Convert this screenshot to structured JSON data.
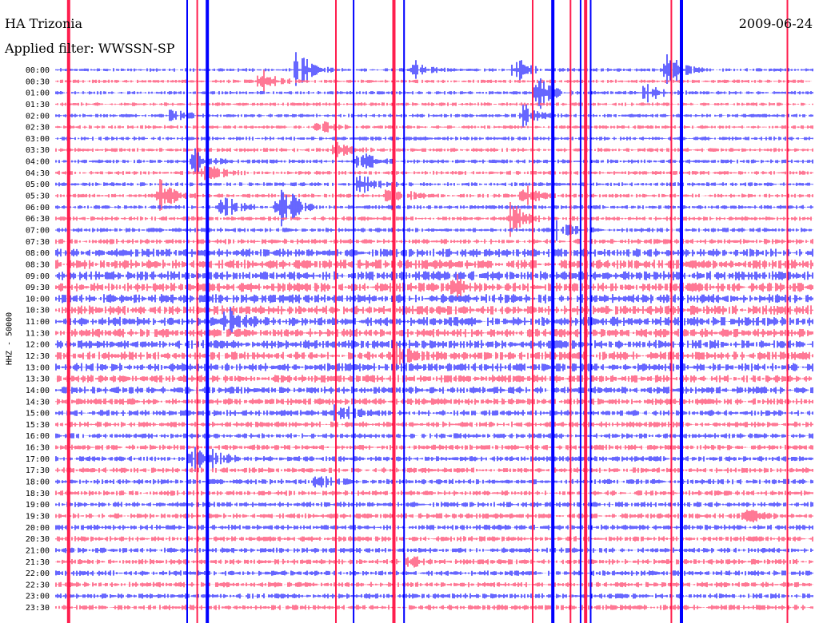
{
  "header": {
    "station": "HA Trizonia",
    "date": "2009-06-24",
    "filter": "Applied filter: WWSSN-SP"
  },
  "chart_data": {
    "type": "helicorder",
    "title": "HA Trizonia",
    "date": "2009-06-24",
    "filter": "Applied filter: WWSSN-SP",
    "ylabel": "HHZ - 50000",
    "row_labels": [
      "00:00",
      "00:30",
      "01:00",
      "01:30",
      "02:00",
      "02:30",
      "03:00",
      "03:30",
      "04:00",
      "04:30",
      "05:00",
      "05:30",
      "06:00",
      "06:30",
      "07:00",
      "07:30",
      "08:00",
      "08:30",
      "09:00",
      "09:30",
      "10:00",
      "10:30",
      "11:00",
      "11:30",
      "12:00",
      "12:30",
      "13:00",
      "13:30",
      "14:00",
      "14:30",
      "15:00",
      "15:30",
      "16:00",
      "16:30",
      "17:00",
      "17:30",
      "18:00",
      "18:30",
      "19:00",
      "19:30",
      "20:00",
      "20:30",
      "21:00",
      "21:30",
      "22:00",
      "22:30",
      "23:00",
      "23:30"
    ],
    "row_minutes": 30,
    "colors": [
      "#0000ff",
      "#ff1e4e"
    ],
    "noise_level": [
      0.25,
      0.25,
      0.25,
      0.25,
      0.25,
      0.25,
      0.3,
      0.3,
      0.3,
      0.3,
      0.3,
      0.3,
      0.3,
      0.35,
      0.35,
      0.45,
      0.8,
      0.9,
      0.9,
      0.9,
      0.9,
      0.9,
      0.9,
      0.85,
      0.85,
      0.8,
      0.8,
      0.7,
      0.65,
      0.6,
      0.55,
      0.5,
      0.45,
      0.45,
      0.45,
      0.45,
      0.45,
      0.45,
      0.45,
      0.45,
      0.45,
      0.45,
      0.45,
      0.45,
      0.45,
      0.45,
      0.45,
      0.45
    ],
    "events": [
      {
        "row": 0,
        "minute": 9.5,
        "amplitude": 6
      },
      {
        "row": 0,
        "minute": 24.2,
        "amplitude": 5
      },
      {
        "row": 0,
        "minute": 18.2,
        "amplitude": 3
      },
      {
        "row": 1,
        "minute": 8.1,
        "amplitude": 3
      },
      {
        "row": 0,
        "minute": 14.2,
        "amplitude": 2
      },
      {
        "row": 2,
        "minute": 19.1,
        "amplitude": 4
      },
      {
        "row": 2,
        "minute": 23.4,
        "amplitude": 3
      },
      {
        "row": 4,
        "minute": 4.6,
        "amplitude": 3
      },
      {
        "row": 4,
        "minute": 18.5,
        "amplitude": 3
      },
      {
        "row": 5,
        "minute": 10.4,
        "amplitude": 2
      },
      {
        "row": 7,
        "minute": 11.1,
        "amplitude": 2
      },
      {
        "row": 8,
        "minute": 5.4,
        "amplitude": 3
      },
      {
        "row": 8,
        "minute": 12.0,
        "amplitude": 3
      },
      {
        "row": 9,
        "minute": 5.9,
        "amplitude": 3
      },
      {
        "row": 10,
        "minute": 12.0,
        "amplitude": 3
      },
      {
        "row": 11,
        "minute": 4.1,
        "amplitude": 4
      },
      {
        "row": 11,
        "minute": 13.2,
        "amplitude": 4
      },
      {
        "row": 11,
        "minute": 18.5,
        "amplitude": 3
      },
      {
        "row": 12,
        "minute": 6.6,
        "amplitude": 4
      },
      {
        "row": 12,
        "minute": 8.8,
        "amplitude": 3
      },
      {
        "row": 12,
        "minute": 9.0,
        "amplitude": 4
      },
      {
        "row": 13,
        "minute": 18.0,
        "amplitude": 4
      },
      {
        "row": 14,
        "minute": 19.8,
        "amplitude": 3
      },
      {
        "row": 19,
        "minute": 15.8,
        "amplitude": 3
      },
      {
        "row": 22,
        "minute": 6.8,
        "amplitude": 3
      },
      {
        "row": 25,
        "minute": 13.5,
        "amplitude": 3
      },
      {
        "row": 30,
        "minute": 11.1,
        "amplitude": 3
      },
      {
        "row": 34,
        "minute": 5.4,
        "amplitude": 3
      },
      {
        "row": 34,
        "minute": 6.0,
        "amplitude": 3
      },
      {
        "row": 36,
        "minute": 10.3,
        "amplitude": 2
      },
      {
        "row": 39,
        "minute": 27.3,
        "amplitude": 2
      },
      {
        "row": 43,
        "minute": 13.8,
        "amplitude": 2
      }
    ],
    "spikes": [
      {
        "minute": 0.5,
        "from_row": 0,
        "to_row": 47
      },
      {
        "minute": 5.2,
        "from_row": 0,
        "to_row": 47
      },
      {
        "minute": 5.6,
        "from_row": 0,
        "to_row": 47
      },
      {
        "minute": 6.0,
        "from_row": 0,
        "to_row": 47
      },
      {
        "minute": 11.1,
        "from_row": 0,
        "to_row": 47
      },
      {
        "minute": 11.8,
        "from_row": 0,
        "to_row": 47
      },
      {
        "minute": 13.4,
        "from_row": 0,
        "to_row": 47
      },
      {
        "minute": 13.8,
        "from_row": 0,
        "to_row": 47
      },
      {
        "minute": 18.9,
        "from_row": 0,
        "to_row": 47
      },
      {
        "minute": 19.7,
        "from_row": 0,
        "to_row": 47
      },
      {
        "minute": 20.4,
        "from_row": 0,
        "to_row": 47
      },
      {
        "minute": 20.8,
        "from_row": 0,
        "to_row": 47
      },
      {
        "minute": 21.0,
        "from_row": 0,
        "to_row": 47
      },
      {
        "minute": 21.2,
        "from_row": 0,
        "to_row": 47
      },
      {
        "minute": 24.4,
        "from_row": 0,
        "to_row": 47
      },
      {
        "minute": 24.8,
        "from_row": 0,
        "to_row": 47
      },
      {
        "minute": 29.0,
        "from_row": 0,
        "to_row": 47
      }
    ]
  }
}
